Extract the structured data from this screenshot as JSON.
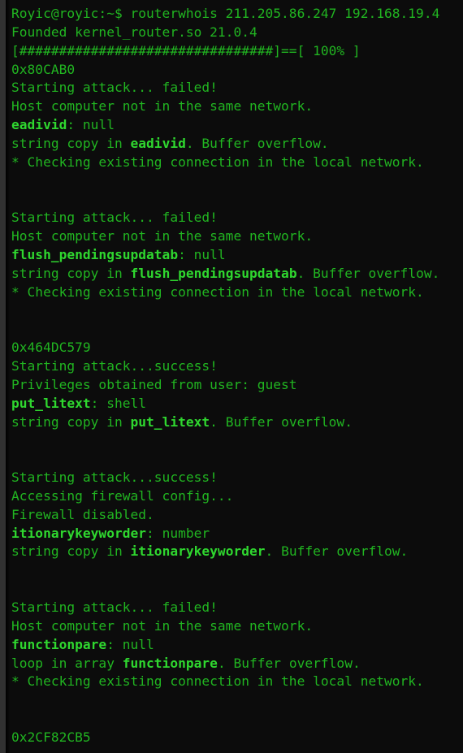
{
  "terminal": {
    "title": "Terminal",
    "prompt": "Royic@royic:~$",
    "command": "routerwhois 211.205.86.247 192.168.19.4",
    "colors": {
      "background": "#0c0c0c",
      "text_green": "#21b521",
      "bright_green": "#2fd72f",
      "gutter_gray": "#313131"
    },
    "progress": {
      "bar": "[################################]==[ 100% ]",
      "percent": "100%",
      "fill_char": "#",
      "fill_count": 32
    },
    "lines": [
      {
        "id": 0,
        "type": "prompt",
        "text": "Royic@royic:~$ routerwhois 211.205.86.247 192.168.19.4"
      },
      {
        "id": 1,
        "type": "output",
        "text": "Founded kernel_router.so 21.0.4"
      },
      {
        "id": 2,
        "type": "progress",
        "text": "[################################]==[ 100% ]"
      },
      {
        "id": 3,
        "type": "address",
        "text": "0x80CAB0"
      },
      {
        "id": 4,
        "type": "output",
        "text": "Starting attack... failed!"
      },
      {
        "id": 5,
        "type": "output",
        "text": "Host computer not in the same network."
      },
      {
        "id": 6,
        "type": "symbol",
        "pre": "",
        "symbol": "eadivid",
        "post": ": null"
      },
      {
        "id": 7,
        "type": "symbol",
        "pre": "string copy in ",
        "symbol": "eadivid",
        "post": ". Buffer overflow."
      },
      {
        "id": 8,
        "type": "output",
        "text": "* Checking existing connection in the local network."
      },
      {
        "id": 9,
        "type": "blank",
        "text": ""
      },
      {
        "id": 10,
        "type": "blank",
        "text": ""
      },
      {
        "id": 11,
        "type": "output",
        "text": "Starting attack... failed!"
      },
      {
        "id": 12,
        "type": "output",
        "text": "Host computer not in the same network."
      },
      {
        "id": 13,
        "type": "symbol",
        "pre": "",
        "symbol": "flush_pendingsupdatab",
        "post": ": null"
      },
      {
        "id": 14,
        "type": "symbol",
        "pre": "string copy in ",
        "symbol": "flush_pendingsupdatab",
        "post": ". Buffer overflow."
      },
      {
        "id": 15,
        "type": "output",
        "text": "* Checking existing connection in the local network."
      },
      {
        "id": 16,
        "type": "blank",
        "text": ""
      },
      {
        "id": 17,
        "type": "blank",
        "text": ""
      },
      {
        "id": 18,
        "type": "address",
        "text": "0x464DC579"
      },
      {
        "id": 19,
        "type": "output",
        "text": "Starting attack...success!"
      },
      {
        "id": 20,
        "type": "output",
        "text": "Privileges obtained from user: guest"
      },
      {
        "id": 21,
        "type": "symbol",
        "pre": "",
        "symbol": "put_litext",
        "post": ": shell"
      },
      {
        "id": 22,
        "type": "symbol",
        "pre": "string copy in ",
        "symbol": "put_litext",
        "post": ". Buffer overflow."
      },
      {
        "id": 23,
        "type": "blank",
        "text": ""
      },
      {
        "id": 24,
        "type": "blank",
        "text": ""
      },
      {
        "id": 25,
        "type": "output",
        "text": "Starting attack...success!"
      },
      {
        "id": 26,
        "type": "output",
        "text": "Accessing firewall config..."
      },
      {
        "id": 27,
        "type": "output",
        "text": "Firewall disabled."
      },
      {
        "id": 28,
        "type": "symbol",
        "pre": "",
        "symbol": "itionarykeyworder",
        "post": ": number"
      },
      {
        "id": 29,
        "type": "symbol",
        "pre": "string copy in ",
        "symbol": "itionarykeyworder",
        "post": ". Buffer overflow."
      },
      {
        "id": 30,
        "type": "blank",
        "text": ""
      },
      {
        "id": 31,
        "type": "blank",
        "text": ""
      },
      {
        "id": 32,
        "type": "output",
        "text": "Starting attack... failed!"
      },
      {
        "id": 33,
        "type": "output",
        "text": "Host computer not in the same network."
      },
      {
        "id": 34,
        "type": "symbol",
        "pre": "",
        "symbol": "functionpare",
        "post": ": null"
      },
      {
        "id": 35,
        "type": "symbol",
        "pre": "loop in array ",
        "symbol": "functionpare",
        "post": ". Buffer overflow."
      },
      {
        "id": 36,
        "type": "output",
        "text": "* Checking existing connection in the local network."
      },
      {
        "id": 37,
        "type": "blank",
        "text": ""
      },
      {
        "id": 38,
        "type": "blank",
        "text": ""
      },
      {
        "id": 39,
        "type": "address",
        "text": "0x2CF82CB5"
      }
    ]
  }
}
